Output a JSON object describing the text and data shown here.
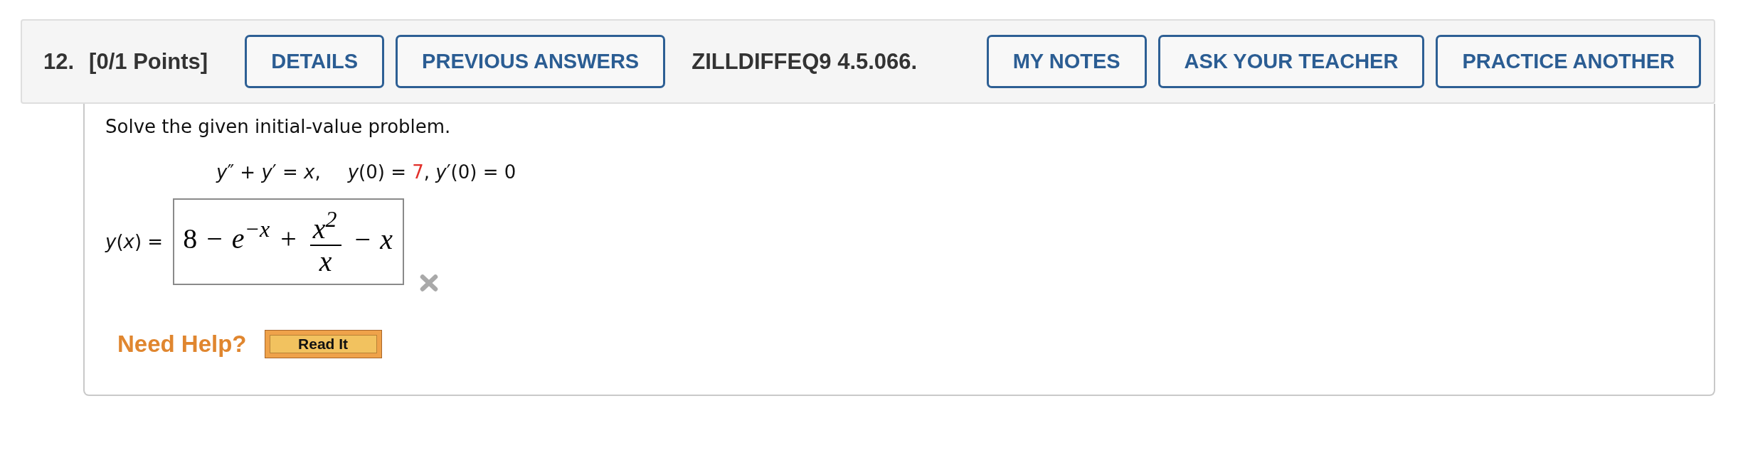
{
  "header": {
    "number": "12.",
    "points": "[0/1 Points]",
    "buttons_left": [
      {
        "label": "DETAILS"
      },
      {
        "label": "PREVIOUS ANSWERS"
      }
    ],
    "code": "ZILLDIFFEQ9 4.5.066.",
    "buttons_right": [
      {
        "label": "MY NOTES"
      },
      {
        "label": "ASK YOUR TEACHER"
      },
      {
        "label": "PRACTICE ANOTHER"
      }
    ]
  },
  "prompt": "Solve the given initial-value problem.",
  "equation": {
    "ode": "*y*″ + *y*′ = *x*,",
    "conditions": [
      {
        "text": "*y*(0) = ",
        "highlighted": false
      },
      {
        "text": "7",
        "highlighted": true
      },
      {
        "text": ", *y*′(0) = 0",
        "highlighted": false
      }
    ]
  },
  "answer": {
    "label": "*y*(*x*) =",
    "value": [
      {
        "kind": "text",
        "text": "8 − *e*$^{−x}$ + "
      },
      {
        "kind": "fraction",
        "numerator": "*x*$^{2}$",
        "denominator": "*x*"
      },
      {
        "kind": "text",
        "text": " − *x*"
      }
    ],
    "correct": false
  },
  "help": {
    "label": "Need Help?",
    "buttons": [
      {
        "label": "Read It"
      }
    ]
  }
}
